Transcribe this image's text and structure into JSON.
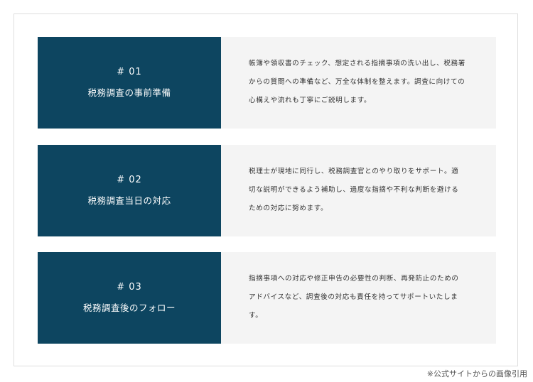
{
  "cards": [
    {
      "number": "# 01",
      "title": "税務調査の事前準備",
      "lines": [
        "帳簿や領収書のチェック、想定される指摘事項の洗い出し、税務署",
        "からの質問への準備など、万全な体制を整えます。調査に向けての",
        "心構えや流れも丁寧にご説明します。"
      ]
    },
    {
      "number": "# 02",
      "title": "税務調査当日の対応",
      "lines": [
        "税理士が現地に同行し、税務調査官とのやり取りをサポート。適",
        "切な説明ができるよう補助し、過度な指摘や不利な判断を避ける",
        "ための対応に努めます。"
      ]
    },
    {
      "number": "# 03",
      "title": "税務調査後のフォロー",
      "lines": [
        "指摘事項への対応や修正申告の必要性の判断、再発防止のための",
        "アドバイスなど、調査後の対応も責任を持ってサポートいたしま",
        "す。"
      ]
    }
  ],
  "caption": "※公式サイトからの画像引用"
}
